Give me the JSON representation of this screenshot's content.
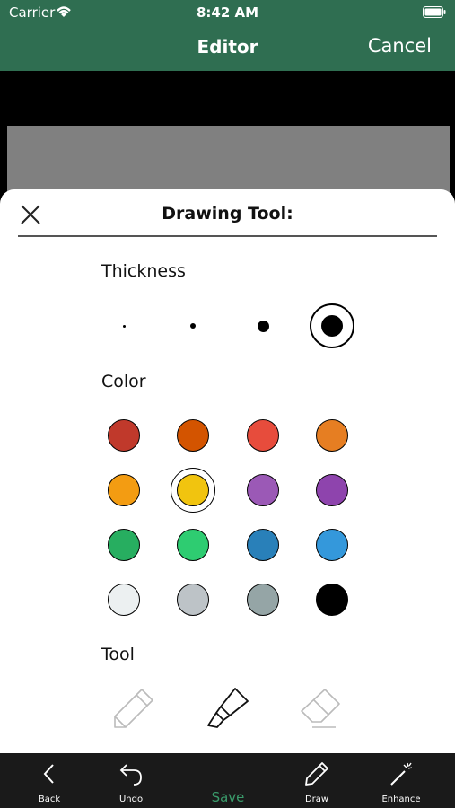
{
  "status": {
    "carrier": "Carrier",
    "time": "8:42 AM"
  },
  "nav": {
    "title": "Editor",
    "cancel_label": "Cancel"
  },
  "sheet": {
    "title": "Drawing Tool:",
    "thickness_label": "Thickness",
    "color_label": "Color",
    "tool_label": "Tool",
    "thickness_selected_index": 3,
    "color_selected_index": 5,
    "tool_selected": "highlighter",
    "colors": [
      "#c0392b",
      "#d35400",
      "#e74c3c",
      "#e67e22",
      "#f39c12",
      "#f1c40f",
      "#9b59b6",
      "#8e44ad",
      "#27ae60",
      "#2ecc71",
      "#2980b9",
      "#3498db",
      "#ecf0f1",
      "#bdc3c7",
      "#95a5a6",
      "#000000"
    ],
    "tools": [
      "pencil",
      "highlighter",
      "eraser"
    ]
  },
  "tabbar": {
    "back": "Back",
    "undo": "Undo",
    "save": "Save",
    "draw": "Draw",
    "enhance": "Enhance"
  }
}
